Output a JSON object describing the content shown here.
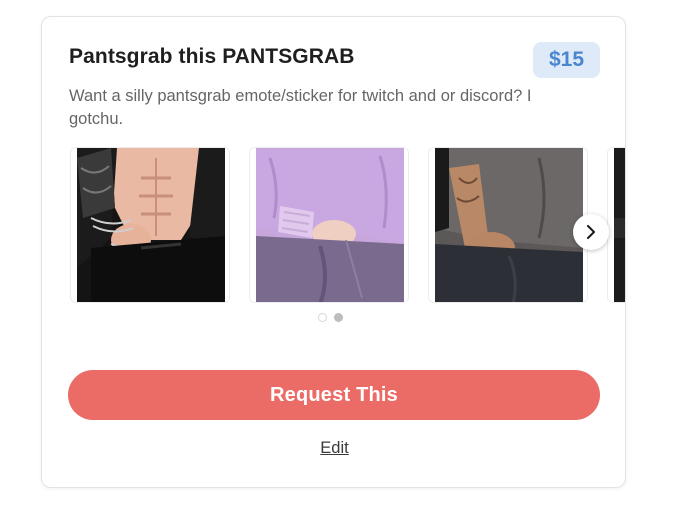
{
  "product": {
    "title": "Pantsgrab this PANTSGRAB",
    "price": "$15",
    "description": "Want a silly pantsgrab emote/sticker for twitch and or discord? I gotchu."
  },
  "carousel": {
    "images": [
      {
        "icon": "pantsgrab-art-black-outfit"
      },
      {
        "icon": "pantsgrab-art-purple-outfit"
      },
      {
        "icon": "pantsgrab-art-grey-outfit"
      },
      {
        "icon": "pantsgrab-art-partial"
      }
    ],
    "pages": 2,
    "current_page": 1,
    "next_icon": "chevron-right-icon"
  },
  "actions": {
    "request_label": "Request This",
    "edit_label": "Edit"
  },
  "colors": {
    "accent": "#eb6b67",
    "price_text": "#4a86cf",
    "price_bg": "#dfeaf8"
  }
}
